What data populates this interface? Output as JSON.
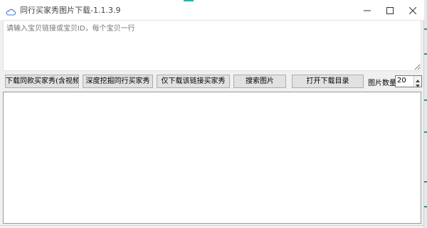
{
  "window": {
    "title": "同行买家秀图片下载-1.1.3.9"
  },
  "input": {
    "placeholder": "请输入宝贝链接或宝贝ID，每个宝贝一行",
    "value": ""
  },
  "toolbar": {
    "btn_download_same": "下载同款买家秀(含视频)",
    "btn_deep_mine": "深度挖掘同行买家秀",
    "btn_download_link_only": "仅下载该链接买家秀",
    "btn_search_images": "搜索图片",
    "btn_open_folder": "打开下载目录",
    "image_count_label": "图片数量",
    "image_count_value": "20"
  },
  "icons": {
    "app": "cloud-icon",
    "minimize": "minimize-icon",
    "maximize": "maximize-icon",
    "close": "close-icon"
  },
  "colors": {
    "accent": "#2bb3a0",
    "button_face": "#e1e1e1",
    "window_bg": "#f0f0f0"
  }
}
